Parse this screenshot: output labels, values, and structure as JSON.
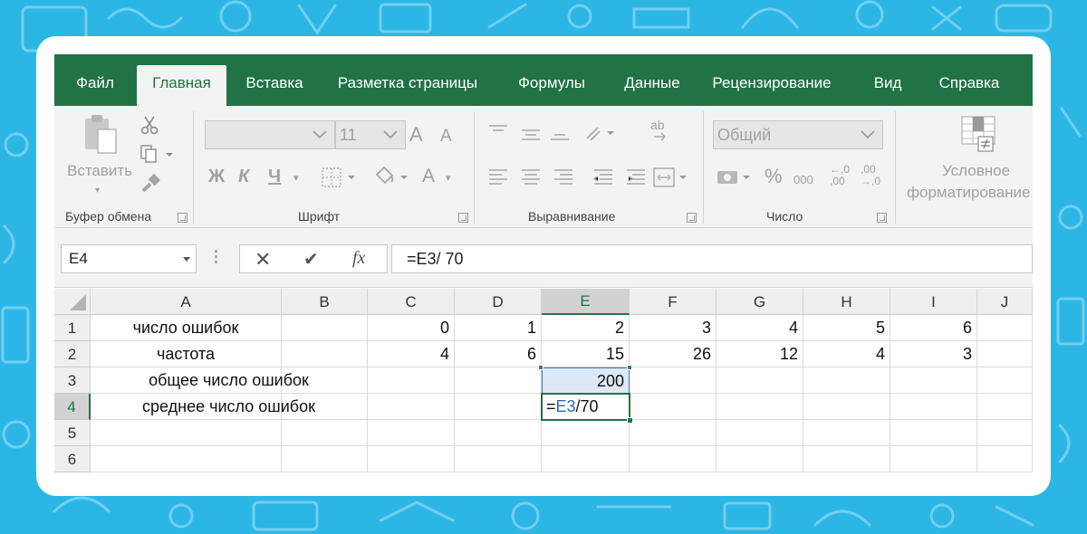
{
  "ribbon": {
    "tabs": [
      "Файл",
      "Главная",
      "Вставка",
      "Разметка страницы",
      "Формулы",
      "Данные",
      "Рецензирование",
      "Вид",
      "Справка"
    ],
    "active_tab": "Главная",
    "groups": {
      "clipboard": {
        "label": "Буфер обмена",
        "paste_label": "Вставить"
      },
      "font": {
        "label": "Шрифт",
        "font_size": "11",
        "bold": "Ж",
        "italic": "К",
        "underline": "Ч",
        "increase_font": "A",
        "decrease_font": "A",
        "font_color": "A"
      },
      "alignment": {
        "label": "Выравнивание",
        "wrap_text": "ab"
      },
      "number": {
        "label": "Число",
        "format": "Общий",
        "percent": "%",
        "thousands": "000",
        "increase_decimal": "←,0\n,00",
        "decrease_decimal": ",00\n→,0"
      },
      "styles": {
        "conditional_line1": "Условное",
        "conditional_line2": "форматирование"
      }
    }
  },
  "formula_bar": {
    "name_box": "E4",
    "cancel_symbol": "✕",
    "enter_symbol": "✔",
    "fx_label": "fx",
    "formula": "=E3/ 70"
  },
  "sheet": {
    "columns": [
      "A",
      "B",
      "C",
      "D",
      "E",
      "F",
      "G",
      "H",
      "I",
      "J"
    ],
    "rows": [
      "1",
      "2",
      "3",
      "4",
      "5",
      "6"
    ],
    "selected_column": "E",
    "selected_row": "4",
    "cells": {
      "A1": "число ошибок",
      "C1": "0",
      "D1": "1",
      "E1": "2",
      "F1": "3",
      "G1": "4",
      "H1": "5",
      "I1": "6",
      "A2": "частота",
      "C2": "4",
      "D2": "6",
      "E2": "15",
      "F2": "26",
      "G2": "12",
      "H2": "4",
      "I2": "3",
      "A3": "общее число ошибок",
      "E3": "200",
      "A4": "среднее число ошибок"
    },
    "edit_formula": {
      "prefix": "=",
      "ref": "E3",
      "suffix": "/70"
    }
  },
  "colors": {
    "background": "#2cb6e6",
    "excel_green": "#217346",
    "reference_blue": "#3169c6",
    "range_highlight": "#dde9f7"
  }
}
